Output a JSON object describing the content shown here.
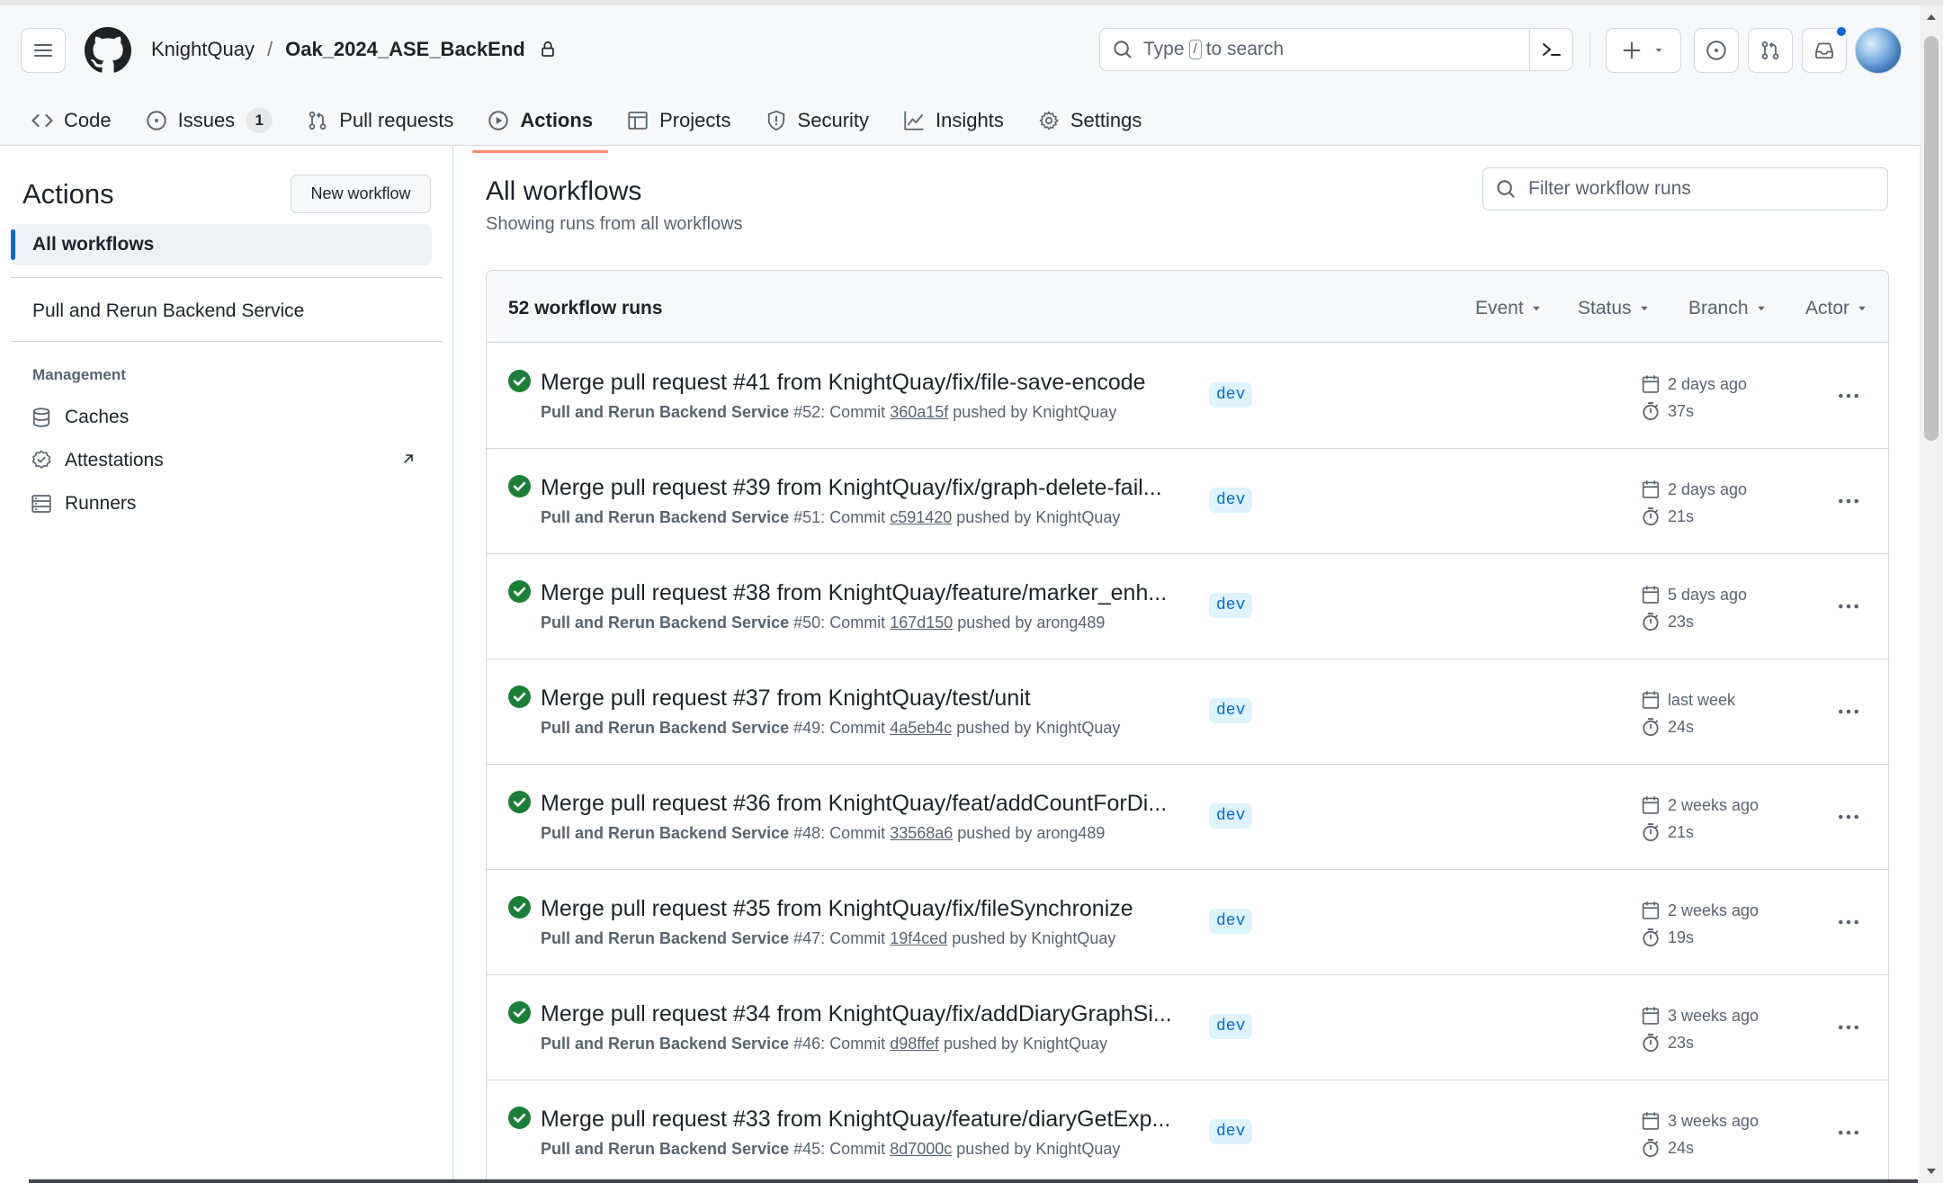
{
  "header": {
    "owner": "KnightQuay",
    "separator": "/",
    "repo": "Oak_2024_ASE_BackEnd",
    "search": {
      "prefix": "Type",
      "key": "/",
      "suffix": "to search"
    }
  },
  "nav": [
    {
      "label": "Code",
      "icon": "code-icon"
    },
    {
      "label": "Issues",
      "icon": "issue-icon",
      "count": "1"
    },
    {
      "label": "Pull requests",
      "icon": "pull-request-icon"
    },
    {
      "label": "Actions",
      "icon": "play-icon",
      "active": true
    },
    {
      "label": "Projects",
      "icon": "table-icon"
    },
    {
      "label": "Security",
      "icon": "shield-icon"
    },
    {
      "label": "Insights",
      "icon": "graph-icon"
    },
    {
      "label": "Settings",
      "icon": "gear-icon"
    }
  ],
  "sidebar": {
    "title": "Actions",
    "new_workflow": "New workflow",
    "all_workflows": "All workflows",
    "workflows": [
      "Pull and Rerun Backend Service"
    ],
    "management_heading": "Management",
    "management": [
      {
        "label": "Caches",
        "icon": "database-icon"
      },
      {
        "label": "Attestations",
        "icon": "verified-icon"
      },
      {
        "label": "Runners",
        "icon": "server-icon"
      }
    ]
  },
  "main": {
    "title": "All workflows",
    "subtitle": "Showing runs from all workflows",
    "filter_placeholder": "Filter workflow runs",
    "runs_count": "52 workflow runs",
    "filters": [
      "Event",
      "Status",
      "Branch",
      "Actor"
    ]
  },
  "runs": [
    {
      "title": "Merge pull request #41 from KnightQuay/fix/file-save-encode",
      "workflow": "Pull and Rerun Backend Service",
      "number": "#52",
      "commit_label": "Commit",
      "sha": "360a15f",
      "pushed_by": "pushed by KnightQuay",
      "branch": "dev",
      "when": "2 days ago",
      "duration": "37s",
      "status": "success"
    },
    {
      "title": "Merge pull request #39 from KnightQuay/fix/graph-delete-fail...",
      "workflow": "Pull and Rerun Backend Service",
      "number": "#51",
      "commit_label": "Commit",
      "sha": "c591420",
      "pushed_by": "pushed by KnightQuay",
      "branch": "dev",
      "when": "2 days ago",
      "duration": "21s",
      "status": "success"
    },
    {
      "title": "Merge pull request #38 from KnightQuay/feature/marker_enh...",
      "workflow": "Pull and Rerun Backend Service",
      "number": "#50",
      "commit_label": "Commit",
      "sha": "167d150",
      "pushed_by": "pushed by arong489",
      "branch": "dev",
      "when": "5 days ago",
      "duration": "23s",
      "status": "success"
    },
    {
      "title": "Merge pull request #37 from KnightQuay/test/unit",
      "workflow": "Pull and Rerun Backend Service",
      "number": "#49",
      "commit_label": "Commit",
      "sha": "4a5eb4c",
      "pushed_by": "pushed by KnightQuay",
      "branch": "dev",
      "when": "last week",
      "duration": "24s",
      "status": "success"
    },
    {
      "title": "Merge pull request #36 from KnightQuay/feat/addCountForDi...",
      "workflow": "Pull and Rerun Backend Service",
      "number": "#48",
      "commit_label": "Commit",
      "sha": "33568a6",
      "pushed_by": "pushed by arong489",
      "branch": "dev",
      "when": "2 weeks ago",
      "duration": "21s",
      "status": "success"
    },
    {
      "title": "Merge pull request #35 from KnightQuay/fix/fileSynchronize",
      "workflow": "Pull and Rerun Backend Service",
      "number": "#47",
      "commit_label": "Commit",
      "sha": "19f4ced",
      "pushed_by": "pushed by KnightQuay",
      "branch": "dev",
      "when": "2 weeks ago",
      "duration": "19s",
      "status": "success"
    },
    {
      "title": "Merge pull request #34 from KnightQuay/fix/addDiaryGraphSi...",
      "workflow": "Pull and Rerun Backend Service",
      "number": "#46",
      "commit_label": "Commit",
      "sha": "d98ffef",
      "pushed_by": "pushed by KnightQuay",
      "branch": "dev",
      "when": "3 weeks ago",
      "duration": "23s",
      "status": "success"
    },
    {
      "title": "Merge pull request #33 from KnightQuay/feature/diaryGetExp...",
      "workflow": "Pull and Rerun Backend Service",
      "number": "#45",
      "commit_label": "Commit",
      "sha": "8d7000c",
      "pushed_by": "pushed by KnightQuay",
      "branch": "dev",
      "when": "3 weeks ago",
      "duration": "24s",
      "status": "success"
    }
  ],
  "colors": {
    "success": "#1a7f37",
    "accent": "#0969da",
    "active_tab": "#fd8c73"
  }
}
